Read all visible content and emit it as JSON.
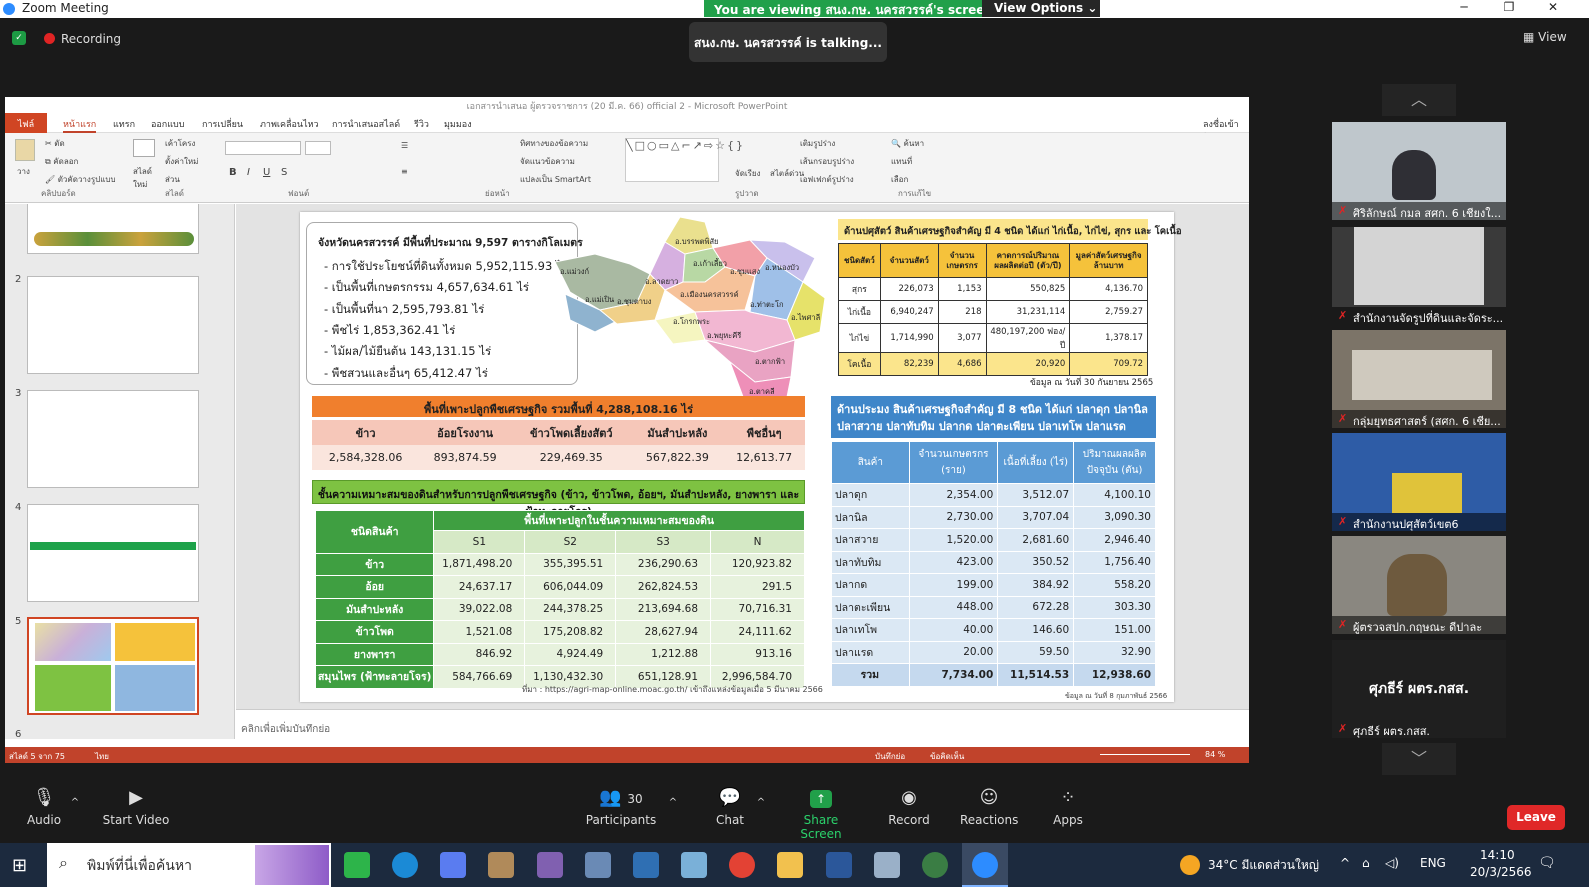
{
  "window": {
    "title": "Zoom Meeting"
  },
  "banner": {
    "viewing": "You are viewing สนง.กษ. นครสวรรค์'s screen",
    "view_options": "View Options"
  },
  "top": {
    "recording": "Recording",
    "talking": "สนง.กษ. นครสวรรค์ is  talking...",
    "view": "View"
  },
  "ppt": {
    "title": "เอกสารนำเสนอ ผู้ตรวจราชการ (20 มี.ค. 66)  official 2 - Microsoft PowerPoint",
    "tabs": [
      "ไฟล์",
      "หน้าแรก",
      "แทรก",
      "ออกแบบ",
      "การเปลี่ยน",
      "ภาพเคลื่อนไหว",
      "การนำเสนอสไลด์",
      "รีวิว",
      "มุมมอง"
    ],
    "signin": "ลงชื่อเข้าใช้",
    "ribbon": {
      "clipboard": [
        "ตัด",
        "คัดลอก",
        "ตัวคัดวางรูปแบบ"
      ],
      "paste": "วาง",
      "new_slide": "สไลด์ใหม่",
      "slide_items": [
        "เค้าโครง",
        "ตั้งค่าใหม่",
        "ส่วน"
      ],
      "drawing_items": [
        "จัดเรียง",
        "สไตล์ด่วน"
      ],
      "shape_items": [
        "เติมรูปร่าง",
        "เส้นกรอบรูปร่าง",
        "เอฟเฟกต์รูปร่าง"
      ],
      "edit_items": [
        "ค้นหา",
        "แทนที่",
        "เลือก"
      ],
      "para_items": [
        "ทิศทางของข้อความ",
        "จัดแนวข้อความ",
        "แปลงเป็น SmartArt"
      ],
      "groups": [
        "คลิปบอร์ด",
        "สไลด์",
        "ฟอนต์",
        "ย่อหน้า",
        "รูปวาด",
        "การแก้ไข"
      ]
    },
    "thumb_numbers": [
      "2",
      "3",
      "4",
      "5",
      "6"
    ],
    "notes_placeholder": "คลิกเพื่อเพิ่มบันทึกย่อ",
    "status_left": "สไลด์ 5 จาก 75",
    "status_lang": "ไทย",
    "status_notes": "บันทึกย่อ",
    "status_comments": "ข้อคิดเห็น",
    "zoom": "84 %"
  },
  "slide": {
    "province": {
      "heading": "จังหวัดนครสวรรค์ มีพื้นที่ประมาณ 9,597 ตารางกิโลเมตร",
      "items": [
        "- การใช้ประโยชน์ที่ดินทั้งหมด 5,952,115.93 ไร่",
        "- เป็นพื้นที่เกษตรกรรม 4,657,634.61 ไร่",
        "- เป็นพื้นที่นา 2,595,793.81  ไร่",
        "- พืชไร่ 1,853,362.41  ไร่",
        "- ไม้ผล/ไม้ยืนต้น 143,131.15 ไร่",
        "- พืชสวนและอื่นๆ 65,412.47 ไร่"
      ]
    },
    "map_labels": [
      "อ.บรรพตพิสัย",
      "อ.แม่วงก์",
      "อ.ลาดยาว",
      "อ.เก้าเลี้ยว",
      "อ.ชุมแสง",
      "อ.หนองบัว",
      "อ.เมืองนครสวรรค์",
      "อ.แม่เปิน",
      "อ.ชุมตาบง",
      "อ.ท่าตะโก",
      "อ.โกรกพระ",
      "อ.ไพศาลี",
      "อ.พยุหะคีรี",
      "อ.ตาคลี",
      "อ.ตากฟ้า"
    ],
    "agri": {
      "title": "พื้นที่เพาะปลูกพืชเศรษฐกิจ รวมพื้นที่ 4,288,108.16 ไร่",
      "headers": [
        "ข้าว",
        "อ้อยโรงงาน",
        "ข้าวโพดเลี้ยงสัตว์",
        "มันสำปะหลัง",
        "พืชอื่นๆ"
      ],
      "values": [
        "2,584,328.06",
        "893,874.59",
        "229,469.35",
        "567,822.39",
        "12,613.77"
      ]
    },
    "suit": {
      "title": "ชั้นความเหมาะสมของดินสำหรับการปลูกพืชเศรษฐกิจ (ข้าว, ข้าวโพด, อ้อยฯ, มันสำปะหลัง, ยางพารา และฟ้าทะลายโจร)",
      "col0": "ชนิดสินค้า",
      "group": "พื้นที่เพาะปลูกในชั้นความเหมาะสมของดิน",
      "sub": [
        "S1",
        "S2",
        "S3",
        "N"
      ],
      "rows": [
        {
          "name": "ข้าว",
          "v": [
            "1,871,498.20",
            "355,395.51",
            "236,290.63",
            "120,923.82"
          ]
        },
        {
          "name": "อ้อย",
          "v": [
            "24,637.17",
            "606,044.09",
            "262,824.53",
            "291.5"
          ]
        },
        {
          "name": "มันสำปะหลัง",
          "v": [
            "39,022.08",
            "244,378.25",
            "213,694.68",
            "70,716.31"
          ]
        },
        {
          "name": "ข้าวโพด",
          "v": [
            "1,521.08",
            "175,208.82",
            "28,627.94",
            "24,111.62"
          ]
        },
        {
          "name": "ยางพารา",
          "v": [
            "846.92",
            "4,924.49",
            "1,212.88",
            "913.16"
          ]
        },
        {
          "name": "สมุนไพร (ฟ้าทะลายโจร)",
          "v": [
            "584,766.69",
            "1,130,432.30",
            "651,128.91",
            "2,996,584.70"
          ]
        }
      ],
      "source": "ที่มา : https://agri-map-online.moac.go.th/ เข้าถึงแหล่งข้อมูลเมื่อ 5 มีนาคม 2566"
    },
    "livestock": {
      "title": "ด้านปศุสัตว์ สินค้าเศรษฐกิจสำคัญ มี 4 ชนิด ได้แก่ ไก่เนื้อ, ไก่ไข่, สุกร และ โคเนื้อ",
      "headers": [
        "ชนิดสัตว์",
        "จำนวนสัตว์",
        "จำนวนเกษตรกร",
        "คาดการณ์ปริมาณผลผลิตต่อปี (ตัว/ปี)",
        "มูลค่าสัตว์เศรษฐกิจล้านบาท"
      ],
      "rows": [
        [
          "สุกร",
          "226,073",
          "1,153",
          "550,825",
          "4,136.70"
        ],
        [
          "ไก่เนื้อ",
          "6,940,247",
          "218",
          "31,231,114",
          "2,759.27"
        ],
        [
          "ไก่ไข่",
          "1,714,990",
          "3,077",
          "480,197,200 ฟอง/ปี",
          "1,378.17"
        ],
        [
          "โคเนื้อ",
          "82,239",
          "4,686",
          "20,920",
          "709.72"
        ]
      ],
      "note": "ข้อมูล ณ วันที่ 30 กันยายน 2565"
    },
    "fishery": {
      "title1": "ด้านประมง สินค้าเศรษฐกิจสำคัญ มี 8 ชนิด ได้แก่ ปลาดุก ปลานิล",
      "title2": "ปลาสวาย ปลาทับทิม ปลากด ปลาตะเพียน ปลาเทโพ ปลาแรด",
      "headers": [
        "สินค้า",
        "จำนวนเกษตรกร (ราย)",
        "เนื้อที่เลี้ยง (ไร่)",
        "ปริมาณผลผลิต ปัจจุบัน (ตัน)"
      ],
      "rows": [
        [
          "ปลาดุก",
          "2,354.00",
          "3,512.07",
          "4,100.10"
        ],
        [
          "ปลานิล",
          "2,730.00",
          "3,707.04",
          "3,090.30"
        ],
        [
          "ปลาสวาย",
          "1,520.00",
          "2,681.60",
          "2,946.40"
        ],
        [
          "ปลาทับทิม",
          "423.00",
          "350.52",
          "1,756.40"
        ],
        [
          "ปลากด",
          "199.00",
          "384.92",
          "558.20"
        ],
        [
          "ปลาตะเพียน",
          "448.00",
          "672.28",
          "303.30"
        ],
        [
          "ปลาเทโพ",
          "40.00",
          "146.60",
          "151.00"
        ],
        [
          "ปลาแรด",
          "20.00",
          "59.50",
          "32.90"
        ]
      ],
      "total": [
        "รวม",
        "7,734.00",
        "11,514.53",
        "12,938.60"
      ],
      "note": "ข้อมูล ณ วันที่ 8 กุมภาพันธ์ 2566"
    }
  },
  "participants_panel": {
    "tiles": [
      "ศิริลักษณ์ กมล สศก. 6 เชียงใ...",
      "สำนักงานจัดรูปที่ดินและจัดระ...",
      "กลุ่มยุทธศาสตร์ (สศก. 6 เชีย...",
      "สำนักงานปศุสัตว์เขต6",
      "ผู้ตรวจสปก.กฤษณะ ดีปาละ"
    ],
    "big_name": "ศุภธีร์ ผตร.กสส.",
    "small_name": "ศุภธีร์ ผตร.กสส."
  },
  "toolbar": {
    "audio": "Audio",
    "video": "Start Video",
    "participants": "Participants",
    "participants_count": "30",
    "chat": "Chat",
    "share": "Share Screen",
    "record": "Record",
    "reactions": "Reactions",
    "apps": "Apps",
    "leave": "Leave"
  },
  "taskbar": {
    "search": "พิมพ์ที่นี่เพื่อค้นหา",
    "weather": "34°C  มีแดดส่วนใหญ่",
    "lang": "ENG",
    "time": "14:10",
    "date": "20/3/2566"
  },
  "colors": {
    "zoom_green": "#21a04a",
    "ppt_red": "#c1432b",
    "leave_red": "#e02828",
    "agri_orange": "#f07f2d",
    "suit_green": "#3f9f41",
    "fish_blue": "#3f86c9",
    "live_yellow": "#f5c23b"
  }
}
